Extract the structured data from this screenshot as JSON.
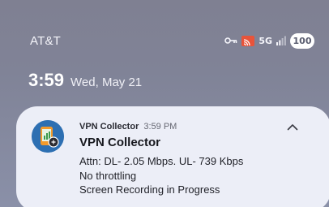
{
  "status_bar": {
    "carrier": "AT&T",
    "network": "5G",
    "battery": "100",
    "icons": [
      "vpn-key-icon",
      "cast-icon",
      "signal-icon",
      "battery-icon"
    ]
  },
  "lockscreen": {
    "time": "3:59",
    "date": "Wed, May 21"
  },
  "notification": {
    "app_name": "VPN Collector",
    "time": "3:59 PM",
    "title": "VPN Collector",
    "lines": [
      "Attn: DL- 2.05 Mbps. UL- 739 Kbps",
      "No throttling",
      "Screen Recording in Progress"
    ],
    "expand_icon": "chevron-up-icon"
  },
  "colors": {
    "background": "#808397",
    "card": "#eceef7",
    "app_icon": "#2d6fb2",
    "cast_icon": "#e8543a"
  }
}
